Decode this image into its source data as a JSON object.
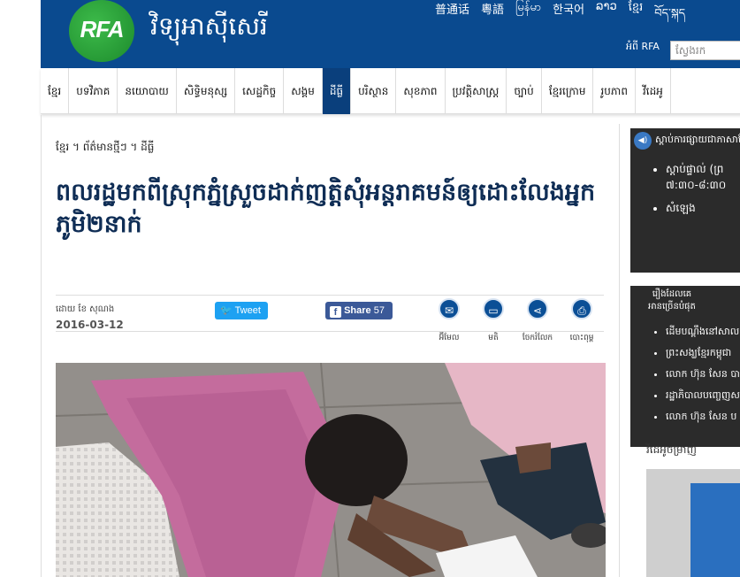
{
  "header": {
    "logo_text": "RFA",
    "site_name": "វិទ្យុអាស៊ីសេរី",
    "languages": [
      "普通话",
      "粵語",
      "မြန်မာ",
      "한국어",
      "ລາວ",
      "ខ្មែរ",
      "བོད་སྐད"
    ],
    "about_label": "អំពី RFA",
    "search_placeholder": "ស្វែងរក"
  },
  "nav": {
    "items": [
      "ខ្មែរ",
      "បទវិភាគ",
      "នយោបាយ",
      "សិទ្ធិមនុស្ស",
      "សេដ្ឋកិច្ច",
      "សង្គម",
      "ដីធ្លី",
      "បរិស្ថាន",
      "សុខភាព",
      "ប្រវត្តិសាស្ត្រ",
      "ច្បាប់",
      "ខ្មែរក្រោម",
      "រូបភាព",
      "វីដេអូ"
    ],
    "active_index": 6
  },
  "article": {
    "breadcrumb": "ខ្មែរ ។ ព័ត៌មានថ្មីៗ ។ ដីធ្លី",
    "headline": "ពលរដ្ឋមកពីស្រុកភ្នំស្រួចដាក់ញត្តិសុំអន្តរាគមន៍ឲ្យដោះលែងអ្នកភូមិ២នាក់",
    "byline": "ដោយ ខែ សុណង",
    "date": "2016-03-12",
    "tweet_label": "Tweet",
    "share_label": "Share",
    "share_count": "57",
    "tools": [
      {
        "icon": "email-icon",
        "label": "អ៊ីមែល"
      },
      {
        "icon": "comment-icon",
        "label": "មតិ"
      },
      {
        "icon": "share-icon",
        "label": "ចែករំលែក"
      },
      {
        "icon": "print-icon",
        "label": "បោះពុម្ព"
      }
    ]
  },
  "sidebar": {
    "listen_title": "ស្ដាប់ការផ្សាយជាភាសាខ្មែរ",
    "listen_items": [
      "ស្ដាប់ផ្ទាល់ (ព្រ",
      "៧:៣០-៨:៣០",
      "សំឡេង"
    ],
    "popular_title_1": "រឿងដែលគេ",
    "popular_title_2": "អានច្រើនបំផុត",
    "popular_items": [
      "ដើមបណ្ដឹងនៅសាល",
      "ព្រះសង្ឃខ្មែរកម្ពុជា",
      "លោក ហ៊ុន សែន បា",
      "រដ្ឋាភិបាលបញ្ចេញស",
      "លោក ហ៊ុន សែន ប"
    ],
    "videos_label": "វីដេអូចម្រាញ់"
  },
  "colors": {
    "header_blue": "#0a4a8f",
    "nav_active": "#0a3f7c",
    "headline": "#0f2d55",
    "tweet": "#1da1f2",
    "facebook": "#3b5998"
  }
}
